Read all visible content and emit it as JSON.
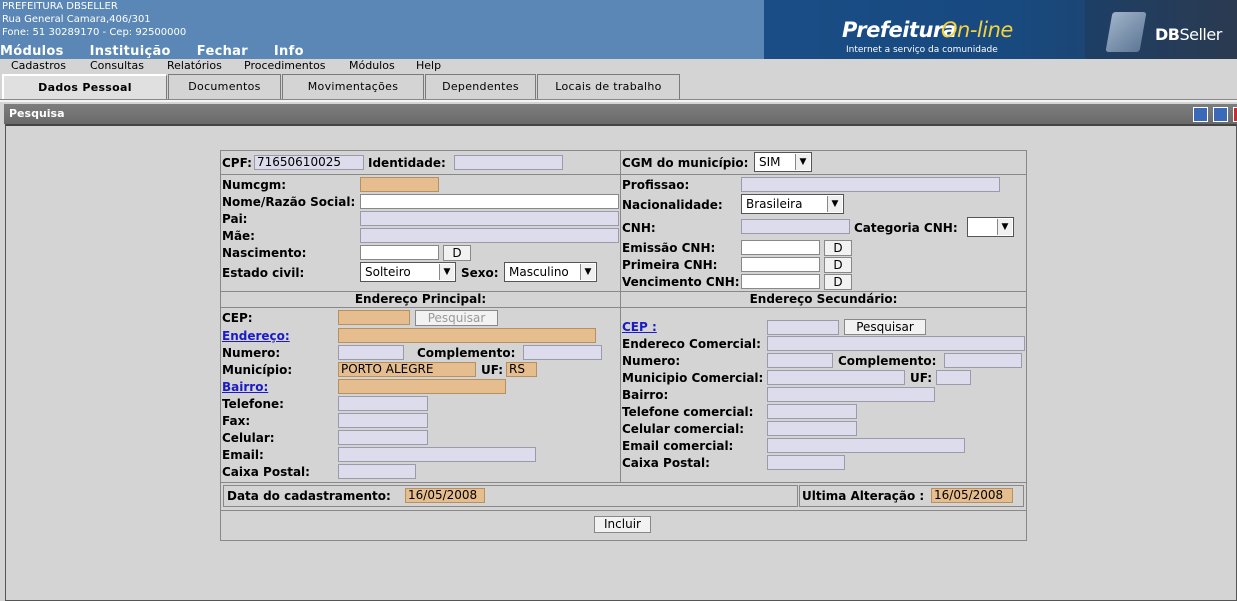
{
  "company": {
    "name": "PREFEITURA DBSELLER",
    "address": "Rua General Camara,406/301",
    "phone": "Fone: 51 30289170  -  Cep: 92500000"
  },
  "top_menu": [
    "Módulos",
    "Instituição",
    "Fechar",
    "Info"
  ],
  "brand": {
    "part1": "Prefeitura",
    "part2": "On-line",
    "tagline": "Internet a serviço da comunidade",
    "dbseller_bold": "DB",
    "dbseller_light": "Seller"
  },
  "sub_menu": [
    "Cadastros",
    "Consultas",
    "Relatórios",
    "Procedimentos",
    "Módulos",
    "Help"
  ],
  "tabs": [
    "Dados Pessoal",
    "Documentos",
    "Movimentações",
    "Dependentes",
    "Locais de trabalho"
  ],
  "panel_title": "Pesquisa",
  "form": {
    "cpf_label": "CPF:",
    "cpf_value": "71650610025",
    "identidade_label": "Identidade:",
    "cgm_label": "CGM do município:",
    "cgm_value": "SIM",
    "numcgm_label": "Numcgm:",
    "profissao_label": "Profissao:",
    "nome_label": "Nome/Razão Social:",
    "nacionalidade_label": "Nacionalidade:",
    "nacionalidade_value": "Brasileira",
    "pai_label": "Pai:",
    "cnh_label": "CNH:",
    "categoria_cnh_label": "Categoria CNH:",
    "mae_label": "Mãe:",
    "emissao_label": "Emissão CNH:",
    "nascimento_label": "Nascimento:",
    "primeira_label": "Primeira CNH:",
    "estado_label": "Estado civil:",
    "estado_value": "Solteiro",
    "sexo_label": "Sexo:",
    "sexo_value": "Masculino",
    "vencimento_label": "Vencimento CNH:",
    "date_btn": "D",
    "end_principal": "Endereço Principal:",
    "end_secundario": "Endereço Secundário:",
    "cep_label": "CEP:",
    "pesquisar": "Pesquisar",
    "endereco_label": "Endereço:",
    "numero_label": "Numero:",
    "complemento_label": "Complemento:",
    "municipio_label": "Município:",
    "municipio_value": "PORTO ALEGRE",
    "uf_label": "UF:",
    "uf_value": "RS",
    "bairro_label": "Bairro:",
    "telefone_label": "Telefone:",
    "fax_label": "Fax:",
    "celular_label": "Celular:",
    "email_label": "Email:",
    "caixa_label": "Caixa Postal:",
    "cep2_label": "CEP :",
    "end_com_label": "Endereco Comercial:",
    "numero2_label": "Numero:",
    "complemento2_label": "Complemento:",
    "mun_com_label": "Municipio Comercial:",
    "uf2_label": "UF:",
    "bairro2_label": "Bairro:",
    "tel_com_label": "Telefone comercial:",
    "cel_com_label": "Celular comercial:",
    "email_com_label": "Email comercial:",
    "caixa2_label": "Caixa Postal:",
    "data_cad_label": "Data do cadastramento:",
    "data_cad_value": "16/05/2008",
    "ult_alt_label": "Ultima Alteração :",
    "ult_alt_value": "16/05/2008",
    "incluir": "Incluir"
  }
}
